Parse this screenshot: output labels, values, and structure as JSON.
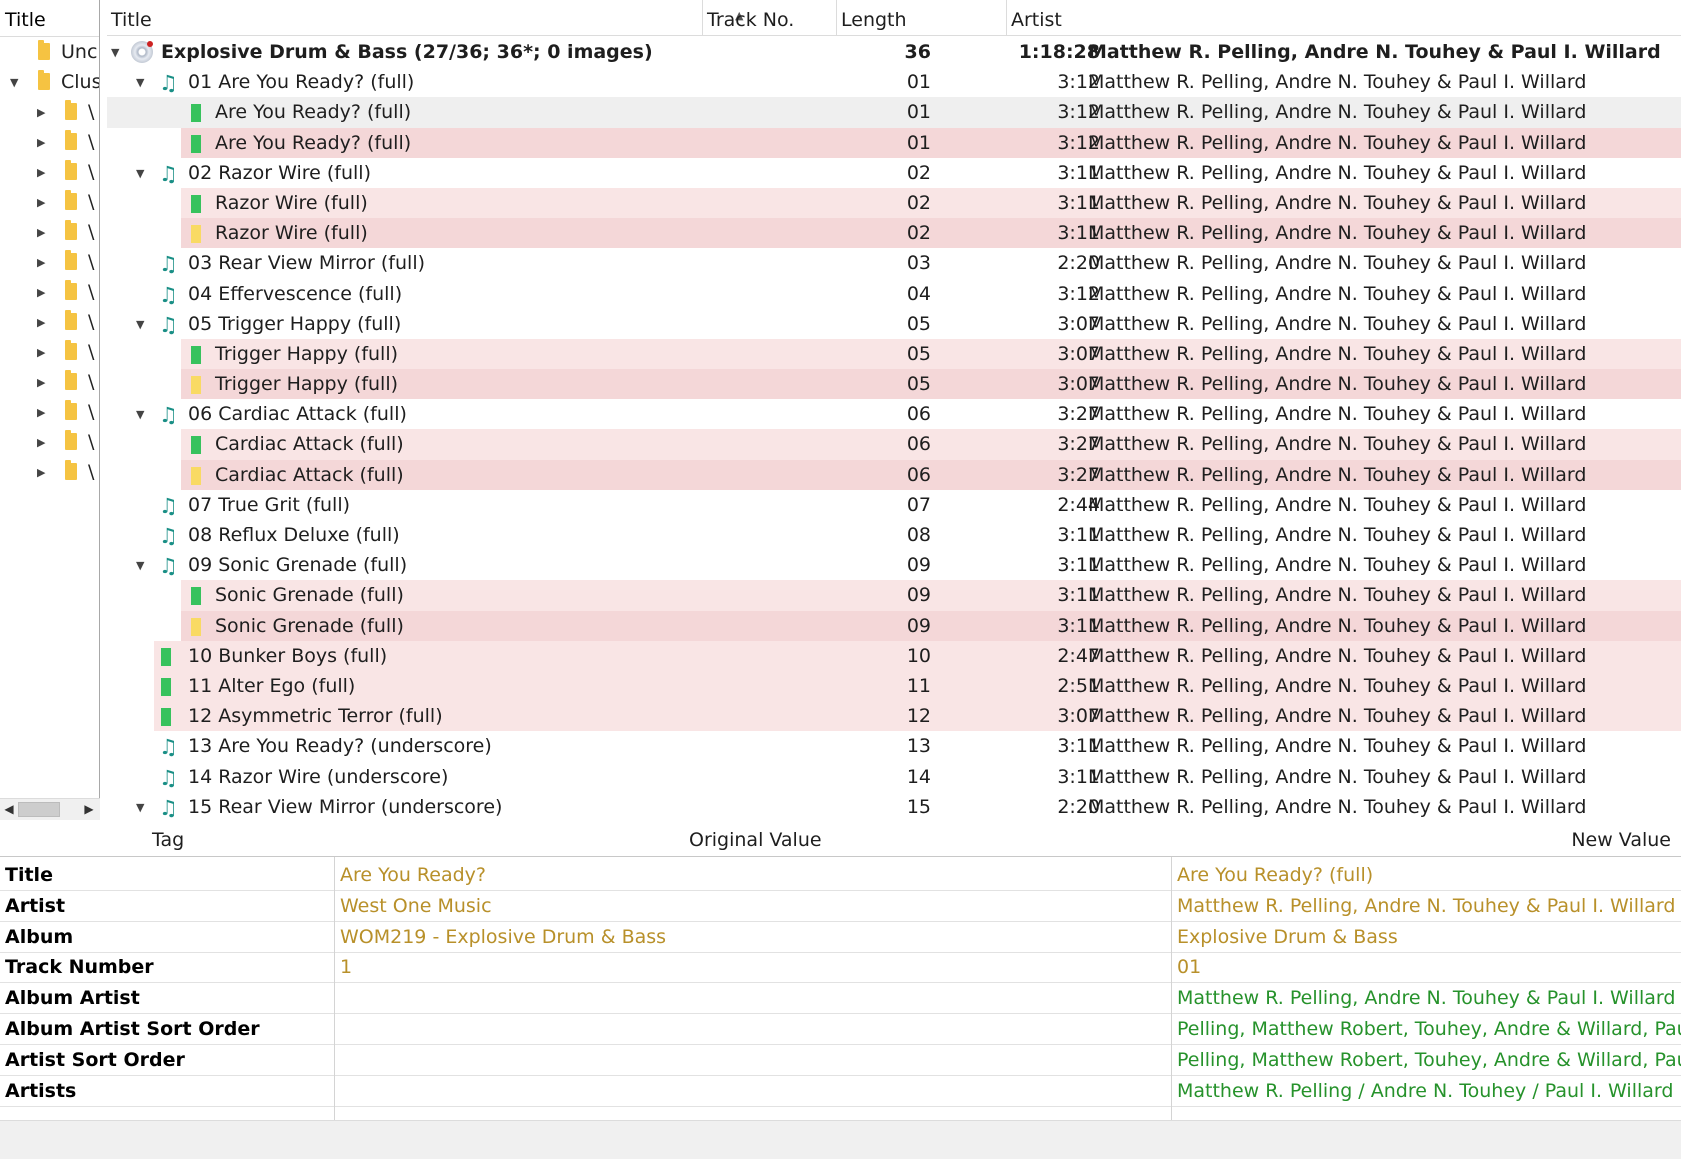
{
  "left_pane": {
    "header": "Title",
    "rows": [
      {
        "label": "Unc",
        "expanded": null,
        "level": 0
      },
      {
        "label": "Clus",
        "expanded": true,
        "level": 0
      },
      {
        "label": "\\",
        "expanded": false,
        "level": 1
      },
      {
        "label": "\\",
        "expanded": false,
        "level": 1
      },
      {
        "label": "\\",
        "expanded": false,
        "level": 1
      },
      {
        "label": "\\",
        "expanded": false,
        "level": 1
      },
      {
        "label": "\\",
        "expanded": false,
        "level": 1
      },
      {
        "label": "\\",
        "expanded": false,
        "level": 1
      },
      {
        "label": "\\",
        "expanded": false,
        "level": 1
      },
      {
        "label": "\\",
        "expanded": false,
        "level": 1
      },
      {
        "label": "\\",
        "expanded": false,
        "level": 1
      },
      {
        "label": "\\",
        "expanded": false,
        "level": 1
      },
      {
        "label": "\\",
        "expanded": false,
        "level": 1
      },
      {
        "label": "\\",
        "expanded": false,
        "level": 1
      },
      {
        "label": "\\",
        "expanded": false,
        "level": 1
      }
    ]
  },
  "main_table": {
    "columns": {
      "title": "Title",
      "track": "Track No.",
      "length": "Length",
      "artist": "Artist"
    },
    "sort_indicator": "ascending",
    "rows": [
      {
        "kind": "album",
        "title": "Explosive Drum & Bass (27/36; 36*; 0 images)",
        "track": "36",
        "length": "1:18:28",
        "artist": "Matthew R. Pelling, Andre N. Touhey & Paul I. Willard",
        "style": "bold",
        "toggle": "open"
      },
      {
        "kind": "track",
        "title": "01  Are You Ready? (full)",
        "track": "01",
        "length": "3:12",
        "artist": "Matthew R. Pelling, Andre N. Touhey & Paul I. Willard",
        "toggle": "open",
        "icon": "music-note",
        "bg": ""
      },
      {
        "kind": "file",
        "title": "Are You Ready? (full)",
        "track": "01",
        "length": "3:12",
        "artist": "Matthew R. Pelling, Andre N. Touhey & Paul I. Willard",
        "icon": "green",
        "bg": "grey"
      },
      {
        "kind": "file",
        "title": "Are You Ready? (full)",
        "track": "01",
        "length": "3:12",
        "artist": "Matthew R. Pelling, Andre N. Touhey & Paul I. Willard",
        "icon": "green",
        "bg": "pink2"
      },
      {
        "kind": "track",
        "title": "02  Razor Wire (full)",
        "track": "02",
        "length": "3:11",
        "artist": "Matthew R. Pelling, Andre N. Touhey & Paul I. Willard",
        "toggle": "open",
        "icon": "music-note",
        "bg": ""
      },
      {
        "kind": "file",
        "title": "Razor Wire (full)",
        "track": "02",
        "length": "3:11",
        "artist": "Matthew R. Pelling, Andre N. Touhey & Paul I. Willard",
        "icon": "green",
        "bg": "pink"
      },
      {
        "kind": "file",
        "title": "Razor Wire (full)",
        "track": "02",
        "length": "3:11",
        "artist": "Matthew R. Pelling, Andre N. Touhey & Paul I. Willard",
        "icon": "yellow",
        "bg": "pink2"
      },
      {
        "kind": "track",
        "title": "03  Rear View Mirror (full)",
        "track": "03",
        "length": "2:20",
        "artist": "Matthew R. Pelling, Andre N. Touhey & Paul I. Willard",
        "toggle": "none",
        "icon": "music-note",
        "bg": ""
      },
      {
        "kind": "track",
        "title": "04  Effervescence (full)",
        "track": "04",
        "length": "3:12",
        "artist": "Matthew R. Pelling, Andre N. Touhey & Paul I. Willard",
        "toggle": "none",
        "icon": "music-note",
        "bg": ""
      },
      {
        "kind": "track",
        "title": "05  Trigger Happy (full)",
        "track": "05",
        "length": "3:07",
        "artist": "Matthew R. Pelling, Andre N. Touhey & Paul I. Willard",
        "toggle": "open",
        "icon": "music-note",
        "bg": ""
      },
      {
        "kind": "file",
        "title": "Trigger Happy (full)",
        "track": "05",
        "length": "3:07",
        "artist": "Matthew R. Pelling, Andre N. Touhey & Paul I. Willard",
        "icon": "green",
        "bg": "pink"
      },
      {
        "kind": "file",
        "title": "Trigger Happy (full)",
        "track": "05",
        "length": "3:07",
        "artist": "Matthew R. Pelling, Andre N. Touhey & Paul I. Willard",
        "icon": "yellow",
        "bg": "pink2"
      },
      {
        "kind": "track",
        "title": "06  Cardiac Attack (full)",
        "track": "06",
        "length": "3:27",
        "artist": "Matthew R. Pelling, Andre N. Touhey & Paul I. Willard",
        "toggle": "open",
        "icon": "music-note",
        "bg": ""
      },
      {
        "kind": "file",
        "title": "Cardiac Attack (full)",
        "track": "06",
        "length": "3:27",
        "artist": "Matthew R. Pelling, Andre N. Touhey & Paul I. Willard",
        "icon": "green",
        "bg": "pink"
      },
      {
        "kind": "file",
        "title": "Cardiac Attack (full)",
        "track": "06",
        "length": "3:27",
        "artist": "Matthew R. Pelling, Andre N. Touhey & Paul I. Willard",
        "icon": "yellow",
        "bg": "pink2"
      },
      {
        "kind": "track",
        "title": "07  True Grit (full)",
        "track": "07",
        "length": "2:44",
        "artist": "Matthew R. Pelling, Andre N. Touhey & Paul I. Willard",
        "toggle": "none",
        "icon": "music-note",
        "bg": ""
      },
      {
        "kind": "track",
        "title": "08  Reflux Deluxe (full)",
        "track": "08",
        "length": "3:11",
        "artist": "Matthew R. Pelling, Andre N. Touhey & Paul I. Willard",
        "toggle": "none",
        "icon": "music-note",
        "bg": ""
      },
      {
        "kind": "track",
        "title": "09  Sonic Grenade (full)",
        "track": "09",
        "length": "3:11",
        "artist": "Matthew R. Pelling, Andre N. Touhey & Paul I. Willard",
        "toggle": "open",
        "icon": "music-note",
        "bg": ""
      },
      {
        "kind": "file",
        "title": "Sonic Grenade (full)",
        "track": "09",
        "length": "3:11",
        "artist": "Matthew R. Pelling, Andre N. Touhey & Paul I. Willard",
        "icon": "green",
        "bg": "pink"
      },
      {
        "kind": "file",
        "title": "Sonic Grenade (full)",
        "track": "09",
        "length": "3:11",
        "artist": "Matthew R. Pelling, Andre N. Touhey & Paul I. Willard",
        "icon": "yellow",
        "bg": "pink2"
      },
      {
        "kind": "track",
        "title": "10  Bunker Boys (full)",
        "track": "10",
        "length": "2:47",
        "artist": "Matthew R. Pelling, Andre N. Touhey & Paul I. Willard",
        "toggle": "none",
        "icon": "green",
        "bg": "pink"
      },
      {
        "kind": "track",
        "title": "11  Alter Ego (full)",
        "track": "11",
        "length": "2:51",
        "artist": "Matthew R. Pelling, Andre N. Touhey & Paul I. Willard",
        "toggle": "none",
        "icon": "green",
        "bg": "pink"
      },
      {
        "kind": "track",
        "title": "12  Asymmetric Terror (full)",
        "track": "12",
        "length": "3:07",
        "artist": "Matthew R. Pelling, Andre N. Touhey & Paul I. Willard",
        "toggle": "none",
        "icon": "green",
        "bg": "pink"
      },
      {
        "kind": "track",
        "title": "13  Are You Ready? (underscore)",
        "track": "13",
        "length": "3:11",
        "artist": "Matthew R. Pelling, Andre N. Touhey & Paul I. Willard",
        "toggle": "none",
        "icon": "music-note",
        "bg": ""
      },
      {
        "kind": "track",
        "title": "14  Razor Wire (underscore)",
        "track": "14",
        "length": "3:11",
        "artist": "Matthew R. Pelling, Andre N. Touhey & Paul I. Willard",
        "toggle": "none",
        "icon": "music-note",
        "bg": ""
      },
      {
        "kind": "track",
        "title": "15  Rear View Mirror (underscore)",
        "track": "15",
        "length": "2:20",
        "artist": "Matthew R. Pelling, Andre N. Touhey & Paul I. Willard",
        "toggle": "open",
        "icon": "music-note",
        "bg": ""
      }
    ]
  },
  "tag_table": {
    "headers": {
      "tag": "Tag",
      "original": "Original Value",
      "new": "New Value"
    },
    "rows": [
      {
        "tag": "Title",
        "original": "Are You Ready?",
        "new": "Are You Ready? (full)",
        "status": "changed"
      },
      {
        "tag": "Artist",
        "original": "West One Music",
        "new": "Matthew R. Pelling, Andre N. Touhey & Paul I. Willard",
        "status": "changed"
      },
      {
        "tag": "Album",
        "original": "WOM219 - Explosive Drum & Bass",
        "new": "Explosive Drum & Bass",
        "status": "changed"
      },
      {
        "tag": "Track Number",
        "original": "1",
        "new": "01",
        "status": "changed"
      },
      {
        "tag": "Album Artist",
        "original": "",
        "new": "Matthew R. Pelling, Andre N. Touhey & Paul I. Willard",
        "status": "added"
      },
      {
        "tag": "Album Artist Sort Order",
        "original": "",
        "new": "Pelling, Matthew Robert, Touhey, Andre & Willard, Paul",
        "status": "added"
      },
      {
        "tag": "Artist Sort Order",
        "original": "",
        "new": "Pelling, Matthew Robert, Touhey, Andre & Willard, Paul",
        "status": "added"
      },
      {
        "tag": "Artists",
        "original": "",
        "new": "Matthew R. Pelling / Andre N. Touhey / Paul I. Willard",
        "status": "added"
      }
    ]
  },
  "colors": {
    "changed": "#b8902a",
    "added": "#26922b",
    "row_pink": "#f9e5e5",
    "row_pink_strong": "#f4d7d8",
    "note": "#1a8f86"
  }
}
